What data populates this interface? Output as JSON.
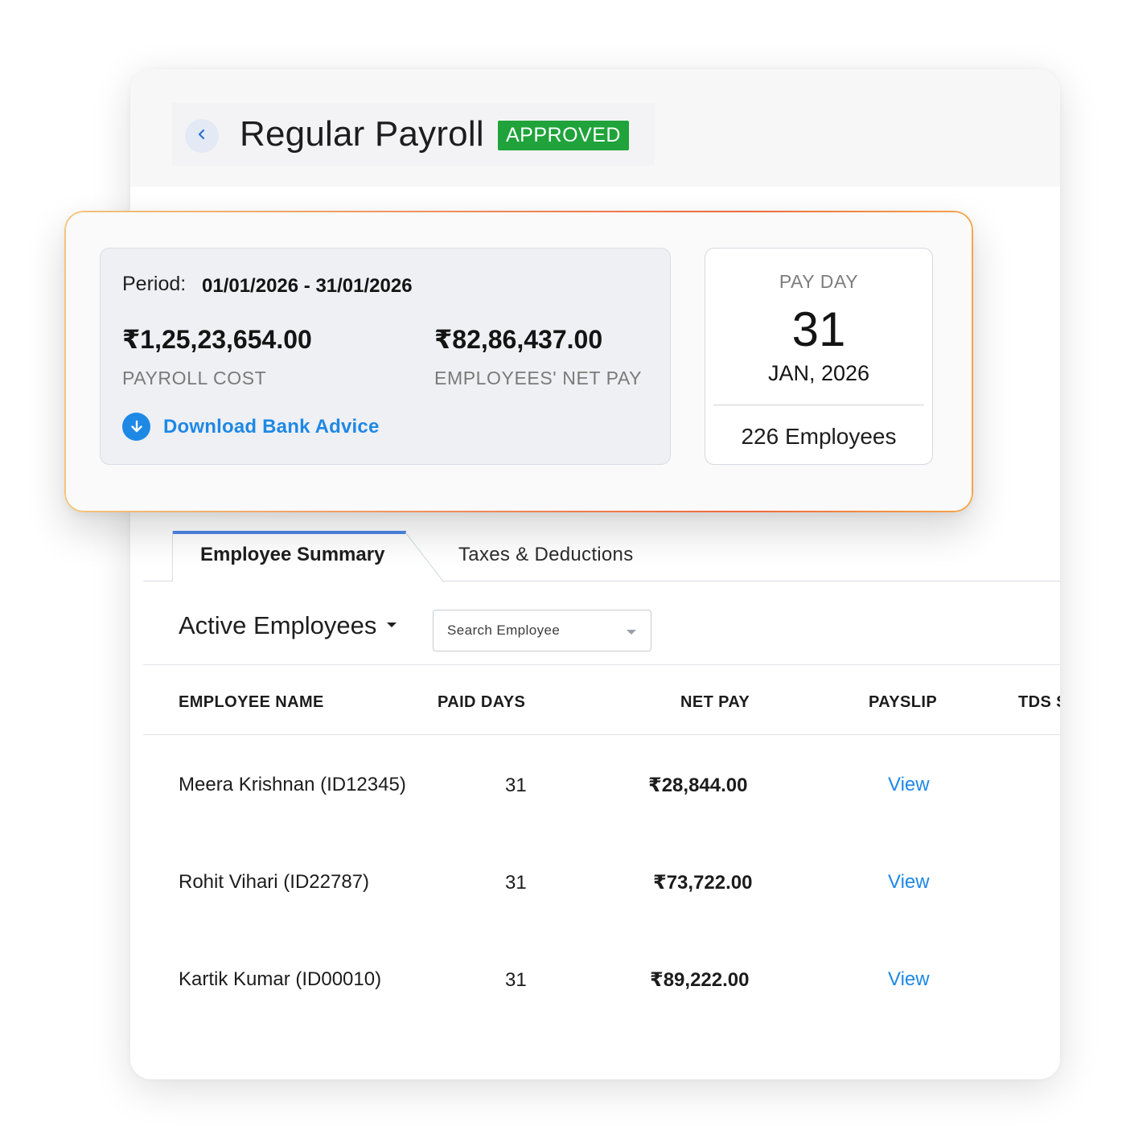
{
  "header": {
    "title": "Regular Payroll",
    "status": "APPROVED",
    "status_color": "#1fa33a"
  },
  "summary": {
    "period_label": "Period:",
    "period_value": "01/01/2026 - 31/01/2026",
    "payroll_cost": "₹1,25,23,654.00",
    "payroll_cost_label": "PAYROLL COST",
    "net_pay": "₹82,86,437.00",
    "net_pay_label": "EMPLOYEES' NET PAY",
    "download_label": "Download Bank Advice",
    "accent_color": "#1e88e5"
  },
  "payday": {
    "title": "PAY DAY",
    "day": "31",
    "month_year": "JAN, 2026",
    "employee_count": "226 Employees"
  },
  "tabs": [
    {
      "label": "Employee Summary",
      "active": true
    },
    {
      "label": "Taxes & Deductions",
      "active": false
    }
  ],
  "filter": {
    "selected": "Active Employees",
    "search_placeholder": "Search Employee"
  },
  "table": {
    "columns": [
      "EMPLOYEE NAME",
      "PAID DAYS",
      "NET PAY",
      "PAYSLIP",
      "TDS S"
    ],
    "rows": [
      {
        "name": "Meera Krishnan (ID12345)",
        "paid_days": "31",
        "net_pay": "₹28,844.00",
        "payslip": "View"
      },
      {
        "name": "Rohit Vihari (ID22787)",
        "paid_days": "31",
        "net_pay": "₹73,722.00",
        "payslip": "View"
      },
      {
        "name": "Kartik Kumar (ID00010)",
        "paid_days": "31",
        "net_pay": "₹89,222.00",
        "payslip": "View"
      }
    ]
  }
}
